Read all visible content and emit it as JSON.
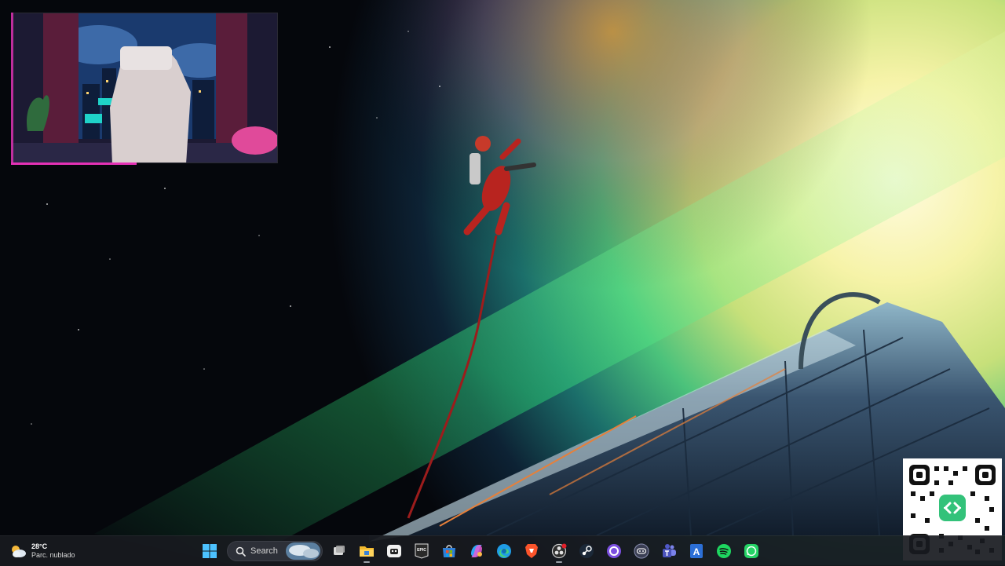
{
  "desktop": {
    "wallpaper": "astronaut-tethered-to-spaceship-aurora",
    "colors": {
      "space": "#05070c",
      "aurora_green": "#3fd97a",
      "aurora_yellow": "#f3ee9a",
      "suit_red": "#b8241f",
      "accent_pink": "#e531b6"
    }
  },
  "webcam": {
    "scene": "lofi-bedroom-rainy-night-city",
    "border_color": "#e531b6"
  },
  "qr": {
    "icon": "qr-code-icon"
  },
  "taskbar": {
    "weather": {
      "temperature": "28°C",
      "condition": "Parc. nublado",
      "icon": "partly-cloudy-icon"
    },
    "search": {
      "label": "Search",
      "icon": "search-icon"
    },
    "apps": [
      {
        "name": "start-button",
        "icon": "windows-logo-icon"
      },
      {
        "name": "search-box"
      },
      {
        "name": "task-view",
        "icon": "task-view-icon"
      },
      {
        "name": "file-explorer",
        "icon": "folder-icon",
        "active": true
      },
      {
        "name": "game-app",
        "icon": "game-app-icon"
      },
      {
        "name": "epic-games",
        "icon": "epic-games-icon",
        "text": "EPIC"
      },
      {
        "name": "microsoft-store",
        "icon": "store-icon"
      },
      {
        "name": "copilot",
        "icon": "copilot-icon"
      },
      {
        "name": "edge",
        "icon": "edge-icon"
      },
      {
        "name": "brave",
        "icon": "brave-icon"
      },
      {
        "name": "obs-studio",
        "icon": "obs-icon",
        "active": true,
        "badge": true
      },
      {
        "name": "steam",
        "icon": "steam-icon"
      },
      {
        "name": "circle-app",
        "icon": "circle-app-icon"
      },
      {
        "name": "controller-app",
        "icon": "controller-icon"
      },
      {
        "name": "teams",
        "icon": "teams-icon"
      },
      {
        "name": "text-app",
        "icon": "text-app-icon",
        "text": "A"
      },
      {
        "name": "spotify",
        "icon": "spotify-icon"
      },
      {
        "name": "whatsapp",
        "icon": "whatsapp-icon"
      }
    ]
  }
}
